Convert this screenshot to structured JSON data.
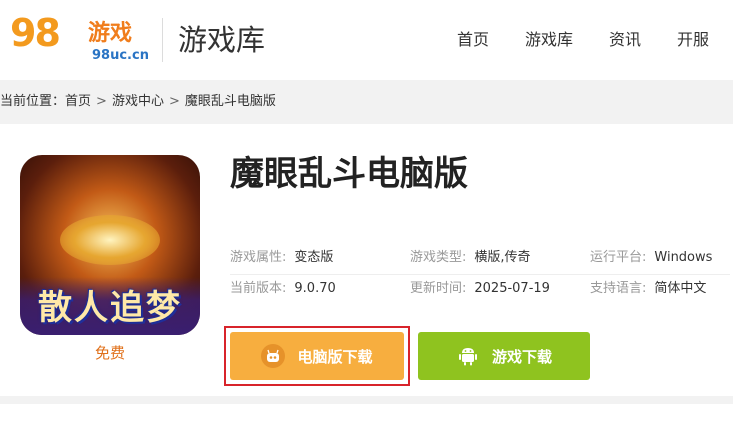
{
  "header": {
    "logo_text": "98",
    "logo_cn": "游戏",
    "logo_url": "98uc.cn",
    "title": "游戏库",
    "nav": [
      {
        "label": "首页"
      },
      {
        "label": "游戏库"
      },
      {
        "label": "资讯"
      },
      {
        "label": "开服"
      }
    ]
  },
  "breadcrumb": {
    "prefix": "当前位置：",
    "items": [
      "首页",
      "游戏中心",
      "魔眼乱斗电脑版"
    ],
    "separator": ">"
  },
  "game": {
    "icon_text": "散人追梦",
    "price": "免费",
    "title": "魔眼乱斗电脑版",
    "attributes": [
      {
        "key": "游戏属性:",
        "value": "变态版"
      },
      {
        "key": "游戏类型:",
        "value": "横版,传奇"
      },
      {
        "key": "运行平台:",
        "value": "Windows"
      },
      {
        "key": "当前版本:",
        "value": "9.0.70"
      },
      {
        "key": "更新时间:",
        "value": "2025-07-19"
      },
      {
        "key": "支持语言:",
        "value": "简体中文"
      }
    ],
    "buttons": {
      "pc_download": "电脑版下载",
      "game_download": "游戏下载"
    }
  },
  "colors": {
    "accent_orange": "#f7ae3f",
    "accent_green": "#8fc31f",
    "highlight_red": "#d8242b",
    "price_orange": "#e0701a"
  }
}
